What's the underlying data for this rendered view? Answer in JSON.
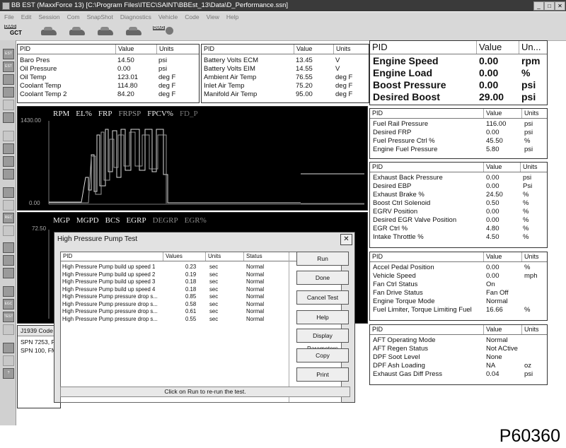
{
  "window": {
    "title": "BB EST (MaxxForce 13) [C:\\Program Files\\ITEC\\SAINT\\BBEst_13\\Data\\D_Performance.ssn]"
  },
  "menu": [
    "File",
    "Edit",
    "Session",
    "Com",
    "SnapShot",
    "Diagnostics",
    "Vehicle",
    "Code",
    "View",
    "Help"
  ],
  "toolbar": {
    "diag_label": "DIAG",
    "gct_label": "GCT"
  },
  "col": {
    "pid": "PID",
    "value": "Value",
    "units": "Units",
    "units_short": "Un...",
    "values": "Values",
    "status": "Status"
  },
  "panel1": [
    {
      "pid": "Baro Pres",
      "value": "14.50",
      "units": "psi"
    },
    {
      "pid": "Oil Pressure",
      "value": "0.00",
      "units": "psi"
    },
    {
      "pid": "Oil Temp",
      "value": "123.01",
      "units": "deg F"
    },
    {
      "pid": "Coolant Temp",
      "value": "114.80",
      "units": "deg F"
    },
    {
      "pid": "Coolant Temp 2",
      "value": "84.20",
      "units": "deg F"
    }
  ],
  "panel2": [
    {
      "pid": "Battery Volts ECM",
      "value": "13.45",
      "units": "V"
    },
    {
      "pid": "Battery Volts EIM",
      "value": "14.55",
      "units": "V"
    },
    {
      "pid": "Ambient Air Temp",
      "value": "76.55",
      "units": "deg F"
    },
    {
      "pid": "Inlet Air Temp",
      "value": "75.20",
      "units": "deg F"
    },
    {
      "pid": "Manifold Air Temp",
      "value": "95.00",
      "units": "deg F"
    }
  ],
  "panel_big": [
    {
      "pid": "Engine Speed",
      "value": "0.00",
      "units": "rpm"
    },
    {
      "pid": "Engine Load",
      "value": "0.00",
      "units": "%"
    },
    {
      "pid": "Boost Pressure",
      "value": "0.00",
      "units": "psi"
    },
    {
      "pid": "Desired Boost",
      "value": "29.00",
      "units": "psi"
    }
  ],
  "panel_fuel": [
    {
      "pid": "Fuel Rail Pressure",
      "value": "116.00",
      "units": "psi"
    },
    {
      "pid": "Desired FRP",
      "value": "0.00",
      "units": "psi"
    },
    {
      "pid": "Fuel Pressure Ctrl %",
      "value": "45.50",
      "units": "%"
    },
    {
      "pid": "Engine Fuel Pressure",
      "value": "5.80",
      "units": "psi"
    }
  ],
  "panel_exhaust": [
    {
      "pid": "Exhaust Back Pressure",
      "value": "0.00",
      "units": "psi"
    },
    {
      "pid": "Desired EBP",
      "value": "0.00",
      "units": "Psi"
    },
    {
      "pid": "Exhaust Brake %",
      "value": "24.50",
      "units": "%"
    },
    {
      "pid": "Boost Ctrl Solenoid",
      "value": "0.50",
      "units": "%"
    },
    {
      "pid": "EGRV Position",
      "value": "0.00",
      "units": "%"
    },
    {
      "pid": "Desired EGR Valve Position",
      "value": "0.00",
      "units": "%"
    },
    {
      "pid": "EGR Ctrl %",
      "value": "4.80",
      "units": "%"
    },
    {
      "pid": "Intake Throttle %",
      "value": "4.50",
      "units": "%"
    }
  ],
  "panel_accel": [
    {
      "pid": "Accel Pedal Position",
      "value": "0.00",
      "units": "%"
    },
    {
      "pid": "Vehicle Speed",
      "value": "0.00",
      "units": "mph"
    },
    {
      "pid": "Fan Ctrl Status",
      "value": "On",
      "units": ""
    },
    {
      "pid": "Fan Drive Status",
      "value": "Fan Off",
      "units": ""
    },
    {
      "pid": "Engine Torque Mode",
      "value": "Normal",
      "units": ""
    },
    {
      "pid": "Fuel Limiter, Torque Limiting Fuel",
      "value": "16.66",
      "units": "%"
    }
  ],
  "panel_aft": [
    {
      "pid": "AFT Operating Mode",
      "value": "Normal",
      "units": ""
    },
    {
      "pid": "AFT Regen Status",
      "value": "Not ACtive",
      "units": ""
    },
    {
      "pid": "DPF Soot Level",
      "value": "None",
      "units": ""
    },
    {
      "pid": "DPF Ash Loading",
      "value": "NA",
      "units": "oz"
    },
    {
      "pid": "Exhaust Gas Diff Press",
      "value": "0.04",
      "units": "psi"
    }
  ],
  "chart1": {
    "legend": [
      "RPM",
      "EL%",
      "FRP",
      "FRPSP",
      "FPCV%",
      "FD_P"
    ],
    "ymax": "1430.00",
    "ymin": "0.00"
  },
  "chart2": {
    "legend": [
      "MGP",
      "MGPD",
      "BCS",
      "EGRP",
      "DEGRP",
      "EGR%"
    ],
    "ymax": "72.50"
  },
  "codes": {
    "header": "J1939 Code",
    "lines": [
      "SPN 7253, F",
      "SPN 100, FM"
    ]
  },
  "dialog": {
    "title": "High Pressure Pump Test",
    "close": "✕",
    "rows": [
      {
        "pid": "High Pressure Pump build up speed 1",
        "value": "0.23",
        "units": "sec",
        "status": "Normal"
      },
      {
        "pid": "High Pressure Pump build up speed 2",
        "value": "0.19",
        "units": "sec",
        "status": "Normal"
      },
      {
        "pid": "High Pressure Pump build up speed 3",
        "value": "0.18",
        "units": "sec",
        "status": "Normal"
      },
      {
        "pid": "High Pressure Pump build up speed 4",
        "value": "0.18",
        "units": "sec",
        "status": "Normal"
      },
      {
        "pid": "High Pressure Pump pressure drop s...",
        "value": "0.85",
        "units": "sec",
        "status": "Normal"
      },
      {
        "pid": "High Pressure Pump pressure drop s...",
        "value": "0.58",
        "units": "sec",
        "status": "Normal"
      },
      {
        "pid": "High Pressure Pump pressure drop s...",
        "value": "0.61",
        "units": "sec",
        "status": "Normal"
      },
      {
        "pid": "High Pressure Pump pressure drop s...",
        "value": "0.55",
        "units": "sec",
        "status": "Normal"
      }
    ],
    "buttons": [
      "Run",
      "Done",
      "Cancel Test",
      "Help",
      "Display Parameters",
      "Copy",
      "Print"
    ],
    "status": "Click on Run to re-run the test."
  },
  "figure_code": "P60360"
}
